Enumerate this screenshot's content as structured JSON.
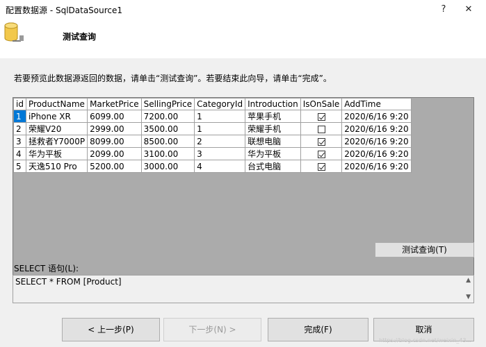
{
  "window": {
    "title": "配置数据源 - SqlDataSource1",
    "help": "?",
    "close": "✕"
  },
  "header": {
    "title": "测试查询"
  },
  "instruction": "若要预览此数据源返回的数据，请单击“测试查询”。若要结束此向导，请单击“完成”。",
  "grid": {
    "columns": [
      "id",
      "ProductName",
      "MarketPrice",
      "SellingPrice",
      "CategoryId",
      "Introduction",
      "IsOnSale",
      "AddTime"
    ],
    "rows": [
      {
        "id": "1",
        "ProductName": "iPhone XR",
        "MarketPrice": "6099.00",
        "SellingPrice": "7200.00",
        "CategoryId": "1",
        "Introduction": "苹果手机",
        "IsOnSale": true,
        "AddTime": "2020/6/16 9:20"
      },
      {
        "id": "2",
        "ProductName": "荣耀V20",
        "MarketPrice": "2999.00",
        "SellingPrice": "3500.00",
        "CategoryId": "1",
        "Introduction": "荣耀手机",
        "IsOnSale": false,
        "AddTime": "2020/6/16 9:20"
      },
      {
        "id": "3",
        "ProductName": "拯救者Y7000P",
        "MarketPrice": "8099.00",
        "SellingPrice": "8500.00",
        "CategoryId": "2",
        "Introduction": "联想电脑",
        "IsOnSale": true,
        "AddTime": "2020/6/16 9:20"
      },
      {
        "id": "4",
        "ProductName": "华为平板",
        "MarketPrice": "2099.00",
        "SellingPrice": "3100.00",
        "CategoryId": "3",
        "Introduction": "华为平板",
        "IsOnSale": true,
        "AddTime": "2020/6/16 9:20"
      },
      {
        "id": "5",
        "ProductName": "天逸510 Pro",
        "MarketPrice": "5200.00",
        "SellingPrice": "3000.00",
        "CategoryId": "4",
        "Introduction": "台式电脑",
        "IsOnSale": true,
        "AddTime": "2020/6/16 9:20"
      }
    ]
  },
  "test_query_button": "测试查询(T)",
  "sql": {
    "label": "SELECT 语句(L):",
    "text": "SELECT * FROM [Product]"
  },
  "footer": {
    "prev": "< 上一步(P)",
    "next": "下一步(N) >",
    "finish": "完成(F)",
    "cancel": "取消"
  },
  "watermark": "https://blog.csdn.net/weixin_43..."
}
